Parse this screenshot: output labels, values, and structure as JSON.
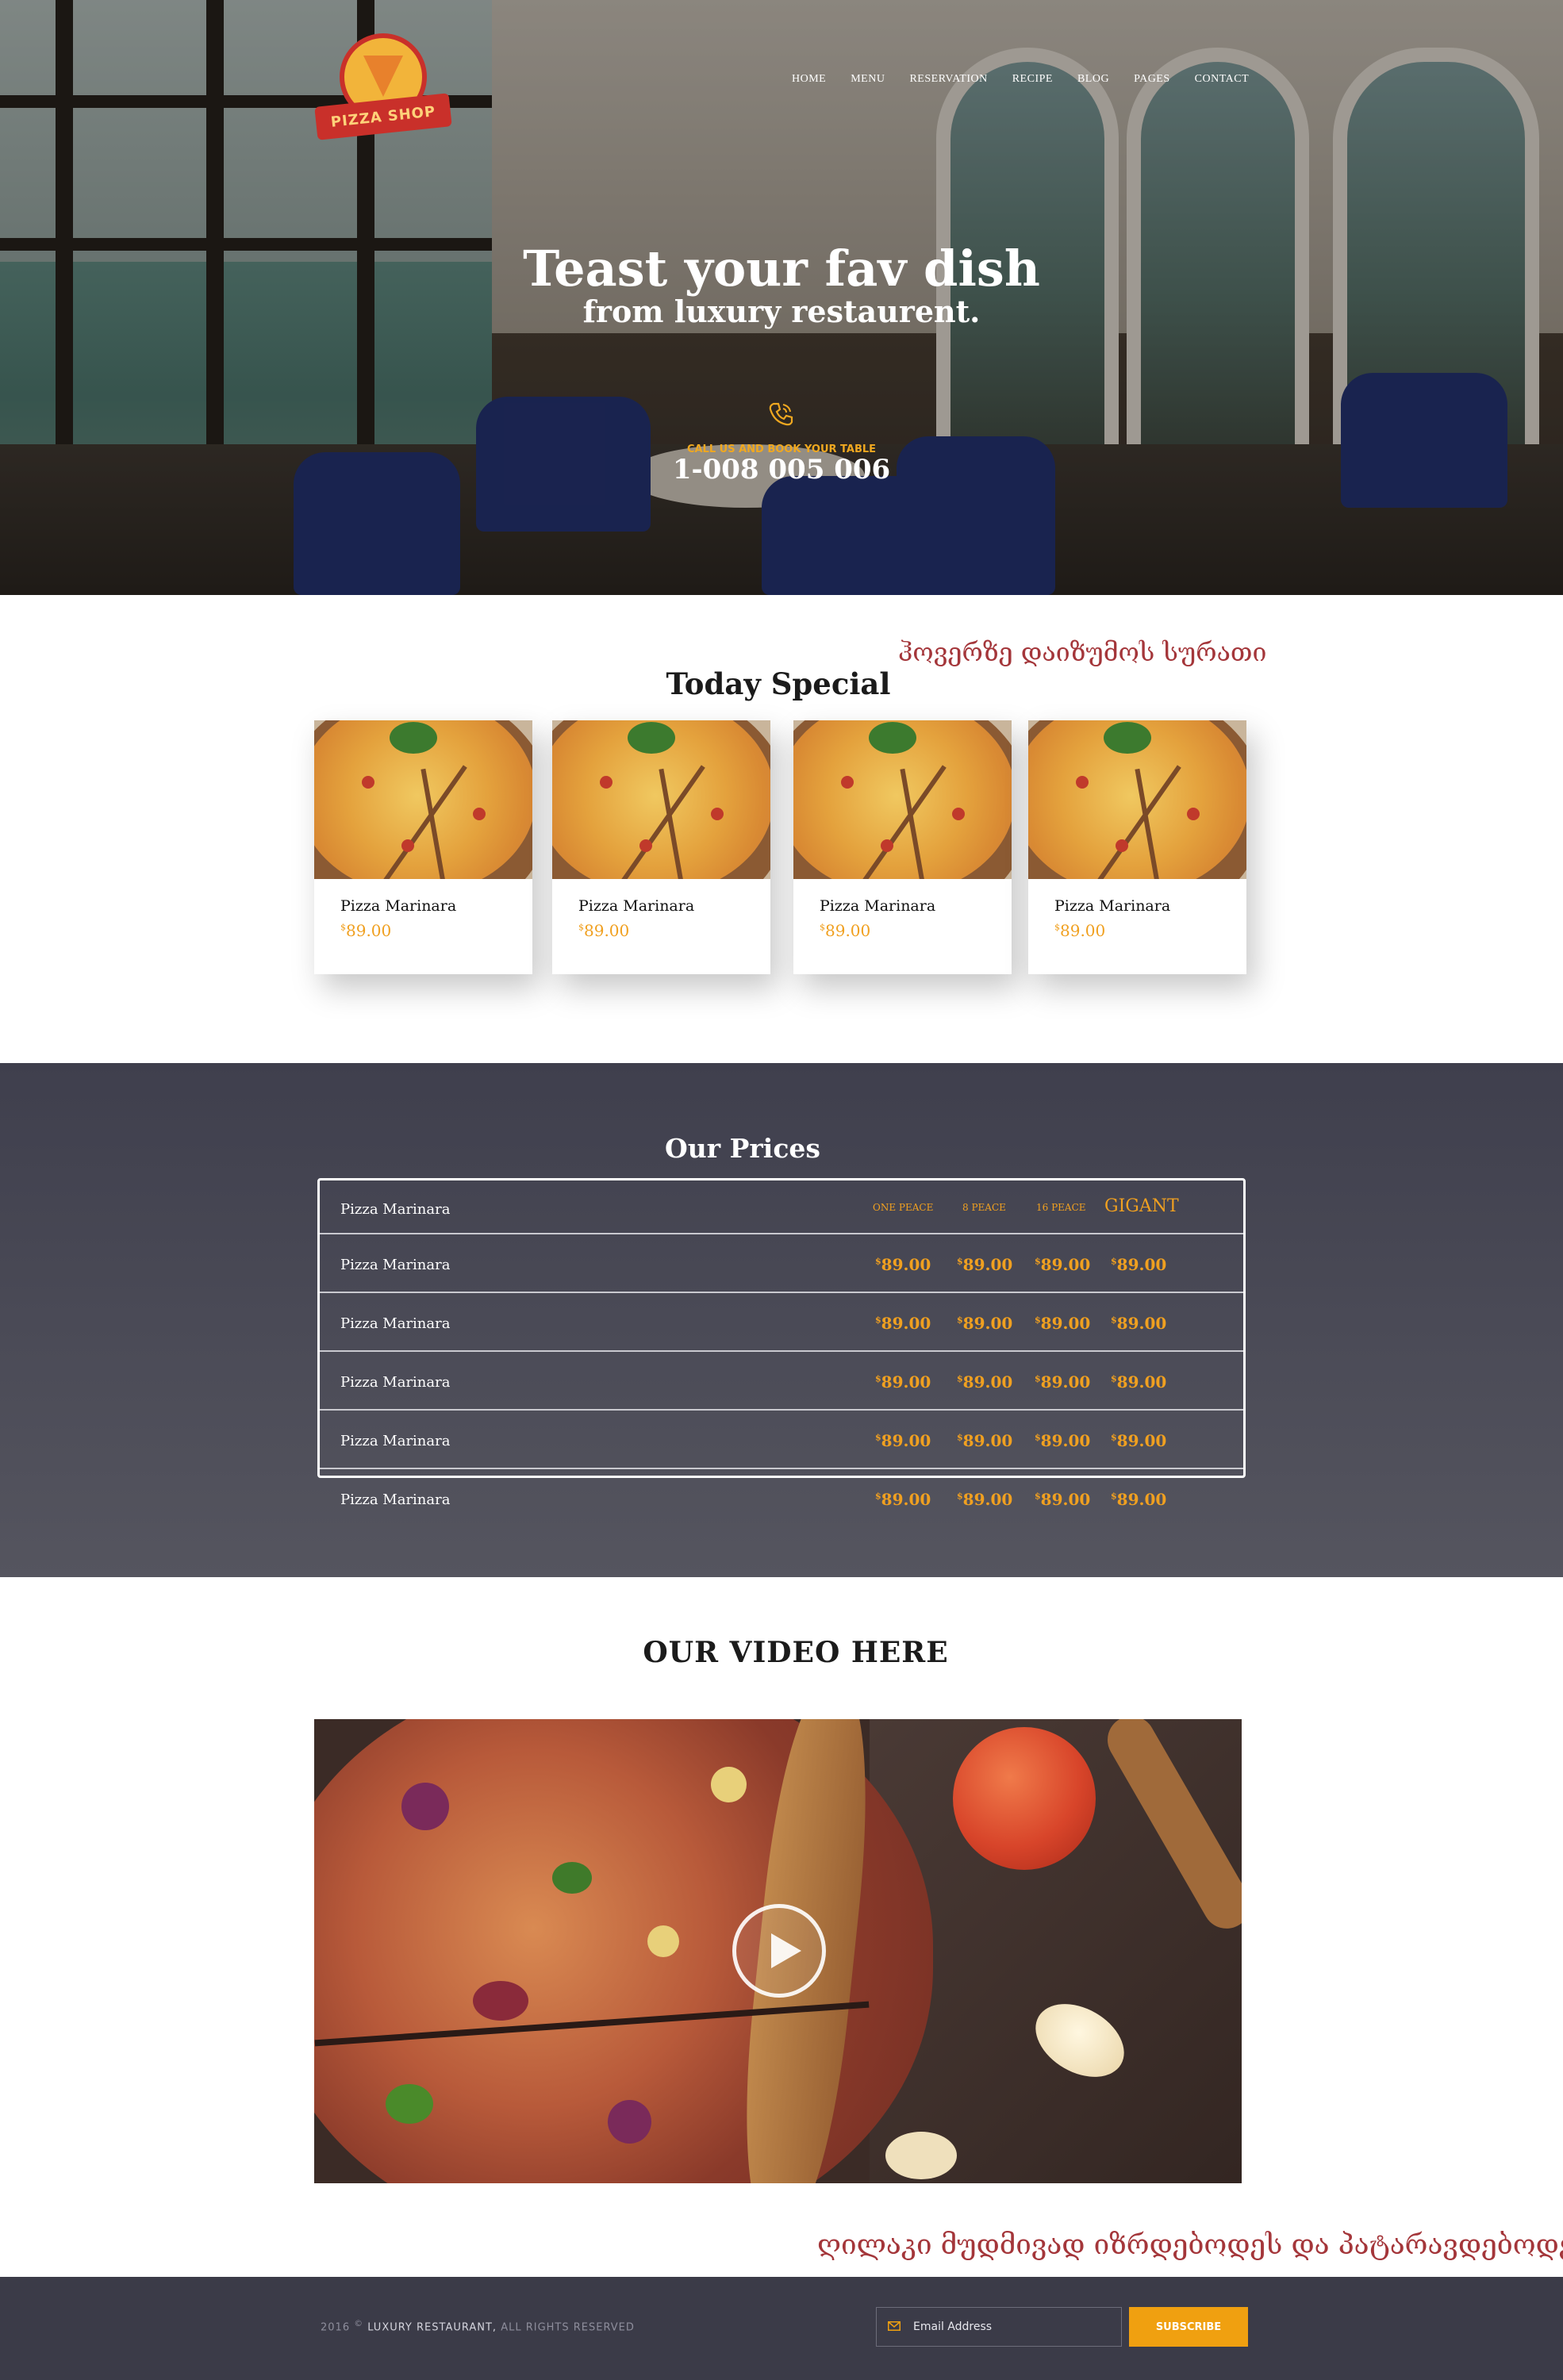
{
  "header": {
    "logo_text": "PIZZA SHOP",
    "nav": [
      "HOME",
      "MENU",
      "RESERVATION",
      "RECIPE",
      "BLOG",
      "PAGES",
      "CONTACT"
    ]
  },
  "hero": {
    "title": "Teast your fav dish",
    "subtitle": "from luxury restaurent.",
    "call_label": "CALL US AND BOOK YOUR TABLE",
    "phone": "1-008 005 006",
    "phone_icon": "phone-icon"
  },
  "hover_note": "ჰოვერზე დაიზუმოს სურათი",
  "special": {
    "title": "Today Special",
    "items": [
      {
        "name": "Pizza Marinara",
        "currency": "$",
        "price": "89.00"
      },
      {
        "name": "Pizza Marinara",
        "currency": "$",
        "price": "89.00"
      },
      {
        "name": "Pizza Marinara",
        "currency": "$",
        "price": "89.00"
      },
      {
        "name": "Pizza Marinara",
        "currency": "$",
        "price": "89.00"
      }
    ]
  },
  "prices": {
    "title": "Our Prices",
    "header": {
      "name": "Pizza Marinara",
      "cols": [
        "ONE PEACE",
        "8 PEACE",
        "16 PEACE",
        "GIGANT"
      ]
    },
    "rows": [
      {
        "name": "Pizza Marinara",
        "currency": "$",
        "values": [
          "89.00",
          "89.00",
          "89.00",
          "89.00"
        ]
      },
      {
        "name": "Pizza Marinara",
        "currency": "$",
        "values": [
          "89.00",
          "89.00",
          "89.00",
          "89.00"
        ]
      },
      {
        "name": "Pizza Marinara",
        "currency": "$",
        "values": [
          "89.00",
          "89.00",
          "89.00",
          "89.00"
        ]
      },
      {
        "name": "Pizza Marinara",
        "currency": "$",
        "values": [
          "89.00",
          "89.00",
          "89.00",
          "89.00"
        ]
      },
      {
        "name": "Pizza Marinara",
        "currency": "$",
        "values": [
          "89.00",
          "89.00",
          "89.00",
          "89.00"
        ]
      }
    ]
  },
  "video": {
    "title": "OUR VIDEO HERE",
    "play_icon": "play-icon"
  },
  "growing_note": "ღილაკი მუდმივად იზრდებოდეს და პატარავდებოდეს",
  "footer": {
    "year": "2016",
    "copyright_symbol": "©",
    "brand": "LUXURY RESTAURANT,",
    "rights": "ALL RIGHTS RESERVED",
    "email_placeholder": "Email Address",
    "subscribe_label": "SUBSCRIBE",
    "mail_icon": "mail-icon"
  },
  "colors": {
    "accent": "#f0a010",
    "note_red": "#a4363a",
    "prices_bg": "#4a4a56",
    "footer_bg": "#3b3b48"
  }
}
